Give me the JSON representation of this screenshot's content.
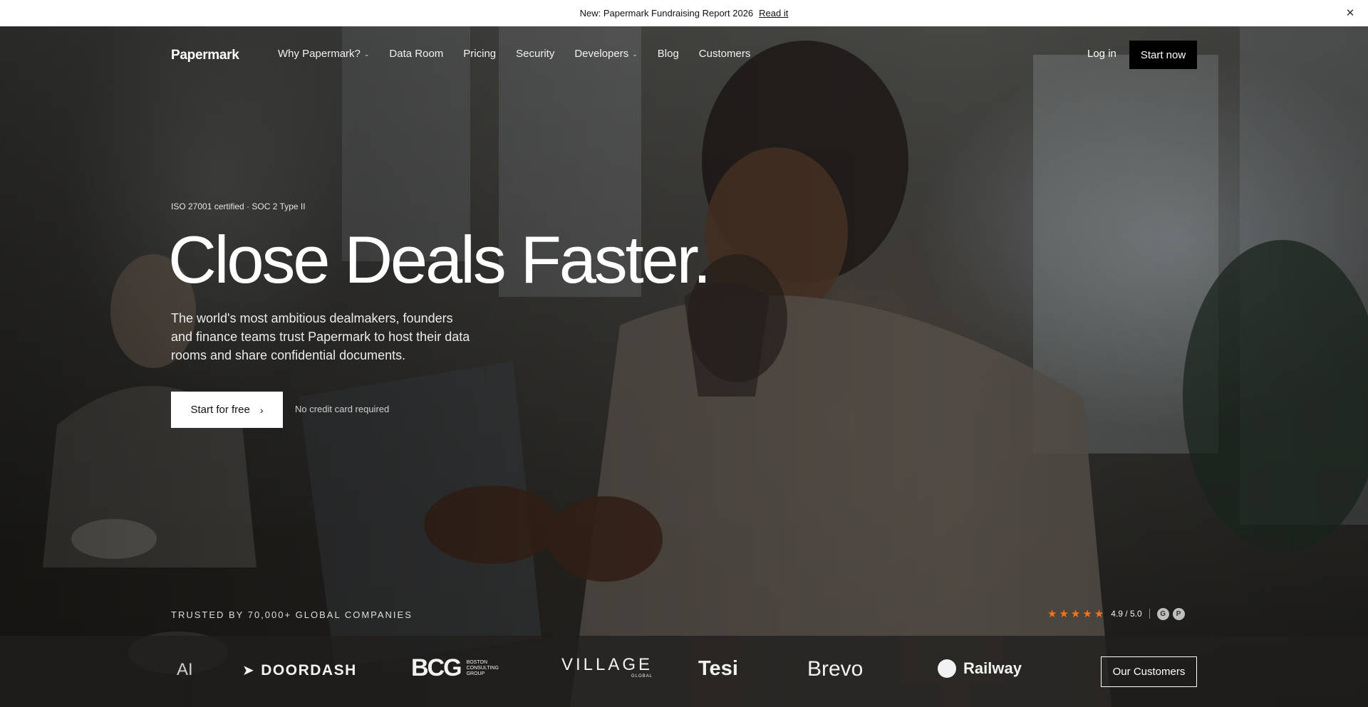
{
  "announcement": {
    "text": "New: Papermark Fundraising Report 2026",
    "link": "Read it",
    "close_glyph": "✕"
  },
  "nav": {
    "logo": "Papermark",
    "items": [
      {
        "label": "Why Papermark?",
        "dropdown": true
      },
      {
        "label": "Data Room",
        "dropdown": false
      },
      {
        "label": "Pricing",
        "dropdown": false
      },
      {
        "label": "Security",
        "dropdown": false
      },
      {
        "label": "Developers",
        "dropdown": true
      },
      {
        "label": "Blog",
        "dropdown": false
      },
      {
        "label": "Customers",
        "dropdown": false
      }
    ],
    "login": "Log in",
    "start_now": "Start now"
  },
  "hero": {
    "certification": "ISO 27001 certified · SOC 2 Type II",
    "headline": "Close Deals Faster.",
    "subcopy": "The world's most ambitious dealmakers, founders and finance teams trust Papermark to host their data rooms and share confidential documents.",
    "cta": "Start for free",
    "cta_note": "No credit card required"
  },
  "trust": {
    "label": "TRUSTED BY 70,000+ GLOBAL COMPANIES",
    "stars": 5,
    "rating": "4.9 / 5.0",
    "badges": [
      "G",
      "P"
    ]
  },
  "customers": {
    "logos": [
      "AI",
      "DOORDASH",
      "BCG",
      "BOSTON CONSULTING GROUP",
      "VILLAGE",
      "GLOBAL",
      "Tesi",
      "Brevo",
      "Railway"
    ],
    "button": "Our Customers"
  },
  "colors": {
    "accent_star": "#f97316",
    "button_dark": "#000000",
    "button_light": "#ffffff"
  }
}
